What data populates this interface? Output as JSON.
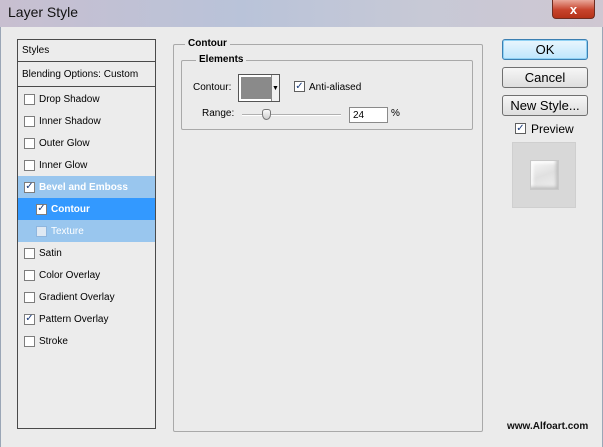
{
  "window": {
    "title": "Layer Style",
    "close_label": "x"
  },
  "styles_panel": {
    "header": "Styles",
    "blending_options": "Blending Options: Custom",
    "items": [
      {
        "label": "Drop Shadow",
        "checked": false
      },
      {
        "label": "Inner Shadow",
        "checked": false
      },
      {
        "label": "Outer Glow",
        "checked": false
      },
      {
        "label": "Inner Glow",
        "checked": false
      },
      {
        "label": "Bevel and Emboss",
        "checked": true
      },
      {
        "label": "Contour",
        "checked": true
      },
      {
        "label": "Texture",
        "checked": false
      },
      {
        "label": "Satin",
        "checked": false
      },
      {
        "label": "Color Overlay",
        "checked": false
      },
      {
        "label": "Gradient Overlay",
        "checked": false
      },
      {
        "label": "Pattern Overlay",
        "checked": true
      },
      {
        "label": "Stroke",
        "checked": false
      }
    ]
  },
  "contour_panel": {
    "group_title": "Contour",
    "elements_title": "Elements",
    "contour_label": "Contour:",
    "anti_aliased_label": "Anti-aliased",
    "anti_aliased_checked": true,
    "range_label": "Range:",
    "range_value": "24",
    "range_unit": "%"
  },
  "buttons": {
    "ok": "OK",
    "cancel": "Cancel",
    "new_style": "New Style...",
    "preview_label": "Preview",
    "preview_checked": true
  },
  "watermark": "www.Alfoart.com",
  "colors": {
    "selected_item": "#3399ff",
    "parent_item": "#99c6ee",
    "dialog_bg": "#ebebeb"
  }
}
